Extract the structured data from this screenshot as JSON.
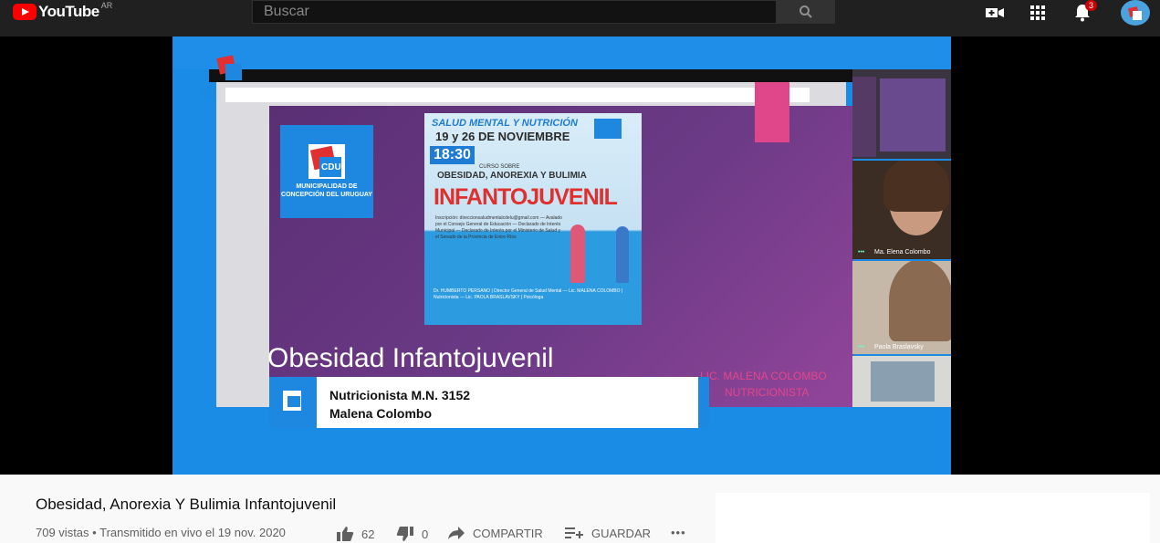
{
  "header": {
    "logo_text": "YouTube",
    "country_code": "AR",
    "search_placeholder": "Buscar",
    "notification_count": "3"
  },
  "video": {
    "slide_title": "Obesidad Infantojuvenil",
    "poster": {
      "line1": "SALUD MENTAL Y NUTRICIÓN",
      "dates": "19 y 26 DE NOVIEMBRE",
      "time": "18:30",
      "curso": "CURSO SOBRE",
      "subtitle": "OBESIDAD, ANOREXIA Y BULIMIA",
      "headline": "INFANTOJUVENIL",
      "inscripcion": "Inscripción: direccionsaludmentalcdelu@gmail.com — Avalado por el Consejo General de Educación — Declarado de Interés Municipal — Declarado de Interés por el Ministerio de Salud y el Senado de la Provincia de Entre Ríos",
      "dictado": "Dr. HUMBERTO PERSANO | Director General de Salud Mental — Lic. MALENA COLOMBO | Nutricionista — Lic. PAOLA BRASLAVSKY | Psicóloga"
    },
    "lower_third_line1": "Nutricionista M.N. 3152",
    "lower_third_line2": "Malena Colombo",
    "speaker_line1": "LIC. MALENA COLOMBO",
    "speaker_line2": "NUTRICIONISTA",
    "logo_caption": "MUNICIPALIDAD DE CONCEPCIÓN DEL URUGUAY",
    "cdu_text": "CDU",
    "participants": [
      {
        "name": "Ma. Elena Colombo"
      },
      {
        "name": "Paola Braslavsky"
      }
    ]
  },
  "info": {
    "title": "Obesidad, Anorexia Y Bulimia Infantojuvenil",
    "views": "709 vistas",
    "separator": "•",
    "streamed": "Transmitido en vivo el 19 nov. 2020",
    "likes": "62",
    "dislikes": "0",
    "share_label": "COMPARTIR",
    "save_label": "GUARDAR",
    "more_label": "•••"
  },
  "colors": {
    "brand_red": "#ff0000",
    "accent_blue": "#1e88e0",
    "slide_purple": "#6c3a86",
    "pink": "#e0478a"
  }
}
